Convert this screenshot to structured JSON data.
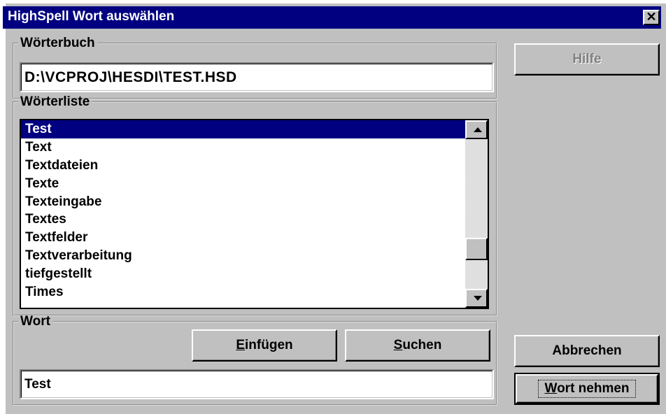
{
  "window": {
    "title": "HighSpell Wort auswählen",
    "close_glyph": "✕"
  },
  "dictionary": {
    "legend": "Wörterbuch",
    "path": "D:\\VCPROJ\\HESDI\\TEST.HSD"
  },
  "wordlist": {
    "legend": "Wörterliste",
    "items": [
      "Test",
      "Text",
      "Textdateien",
      "Texte",
      "Texteingabe",
      "Textes",
      "Textfelder",
      "Textverarbeitung",
      "tiefgestellt",
      "Times"
    ],
    "selected_index": 0
  },
  "word": {
    "legend": "Wort",
    "value": "Test",
    "insert_button": {
      "mnemonic": "E",
      "rest": "infügen"
    },
    "search_button": {
      "mnemonic": "S",
      "rest": "uchen"
    }
  },
  "side_buttons": {
    "help": "Hilfe",
    "cancel": "Abbrechen",
    "take": {
      "mnemonic": "W",
      "rest": "ort nehmen"
    }
  },
  "colors": {
    "titlebar": "#000080",
    "face": "#c0c0c0",
    "selection": "#000080"
  }
}
